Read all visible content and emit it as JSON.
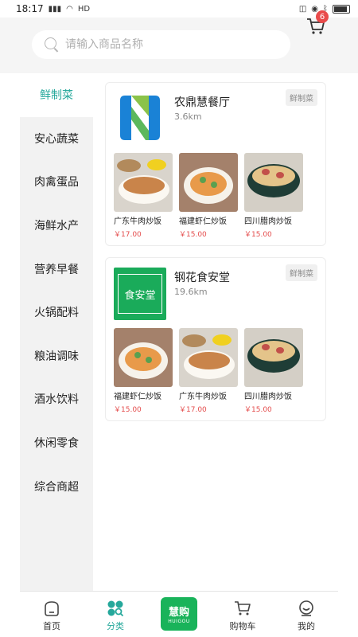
{
  "status_bar": {
    "time": "18:17",
    "network": "HD"
  },
  "search": {
    "placeholder": "请输入商品名称"
  },
  "cart": {
    "badge": "6"
  },
  "sidebar": {
    "items": [
      {
        "label": "鲜制菜",
        "active": true
      },
      {
        "label": "安心蔬菜"
      },
      {
        "label": "肉禽蛋品"
      },
      {
        "label": "海鲜水产"
      },
      {
        "label": "营养早餐"
      },
      {
        "label": "火锅配料"
      },
      {
        "label": "粮油调味"
      },
      {
        "label": "酒水饮料"
      },
      {
        "label": "休闲零食"
      },
      {
        "label": "综合商超"
      }
    ]
  },
  "stores": [
    {
      "name": "农鼎慧餐厅",
      "distance": "3.6km",
      "tag": "鲜制菜",
      "products": [
        {
          "name": "广东牛肉炒饭",
          "price": "￥17.00"
        },
        {
          "name": "福建虾仁炒饭",
          "price": "￥15.00"
        },
        {
          "name": "四川腊肉炒饭",
          "price": "￥15.00"
        }
      ]
    },
    {
      "name": "钢花食安堂",
      "distance": "19.6km",
      "tag": "鲜制菜",
      "logo_text": "食安堂",
      "products": [
        {
          "name": "福建虾仁炒饭",
          "price": "￥15.00"
        },
        {
          "name": "广东牛肉炒饭",
          "price": "￥17.00"
        },
        {
          "name": "四川腊肉炒饭",
          "price": "￥15.00"
        }
      ]
    }
  ],
  "bottom_nav": {
    "items": [
      {
        "label": "首页"
      },
      {
        "label": "分类",
        "active": true
      },
      {
        "label": "慧购",
        "sub": "HUIGOU"
      },
      {
        "label": "购物车"
      },
      {
        "label": "我的"
      }
    ]
  },
  "colors": {
    "accent": "#25a89b",
    "price": "#e44c4c",
    "badge": "#e94b4b",
    "brand_green": "#19b35a"
  }
}
